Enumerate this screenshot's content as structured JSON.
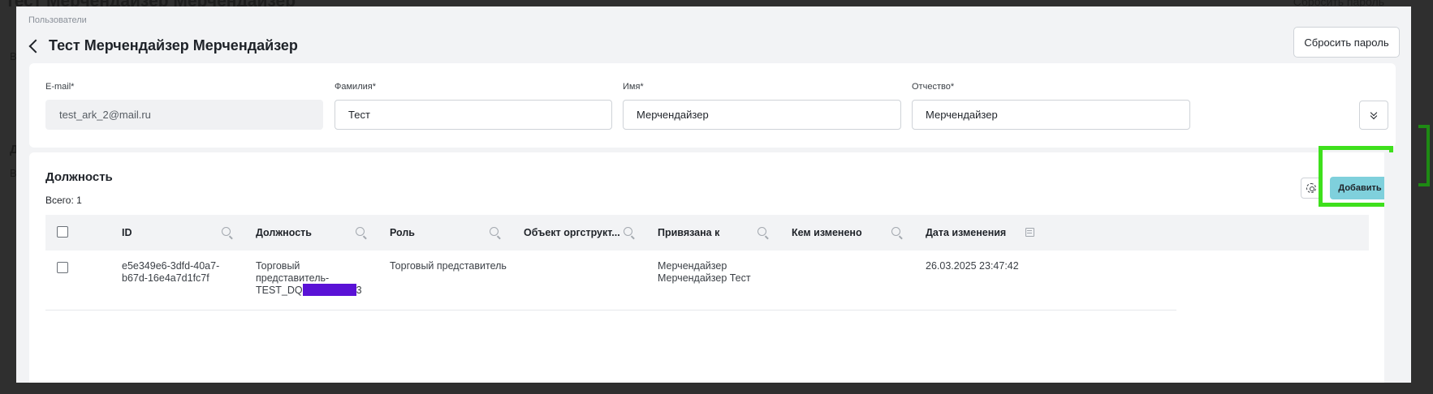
{
  "backdrop": {
    "title": "Тест Мерчендайзер Мерчендайзер",
    "right_text": "Сбросить пароль"
  },
  "modal": {
    "breadcrumb": "Пользователи",
    "title": "Тест Мерчендайзер Мерчендайзер",
    "reset_password_label": "Сбросить пароль"
  },
  "fields": {
    "email": {
      "label": "E-mail*",
      "value": "test_ark_2@mail.ru"
    },
    "last_name": {
      "label": "Фамилия*",
      "value": "Тест"
    },
    "first_name": {
      "label": "Имя*",
      "value": "Мерчендайзер"
    },
    "middle_name": {
      "label": "Отчество*",
      "value": "Мерчендайзер"
    }
  },
  "positions": {
    "title": "Должность",
    "total": "Всего: 1",
    "add_label": "Добавить",
    "columns": [
      "ID",
      "Должность",
      "Роль",
      "Объект оргструкт...",
      "Привязана к",
      "Кем изменено",
      "Дата изменения"
    ],
    "rows": [
      {
        "id_line1": "e5e349e6-3dfd-40a7-",
        "id_line2": "b67d-16e4a7d1fc7f",
        "position_line1": "Торговый",
        "position_line2": "представитель-",
        "position_line3_prefix": "TEST_DQ",
        "position_line3_suffix": "3",
        "role": "Торговый представитель",
        "org_object": "",
        "linked_line1": "Мерчендайзер",
        "linked_line2": "Мерчендайзер Тест",
        "changed_by": "",
        "changed_at": "26.03.2025 23:47:42"
      }
    ]
  },
  "colors": {
    "add_button": "#7fd0dc",
    "highlight": "#3ee01c",
    "redaction": "#5a12d6"
  }
}
